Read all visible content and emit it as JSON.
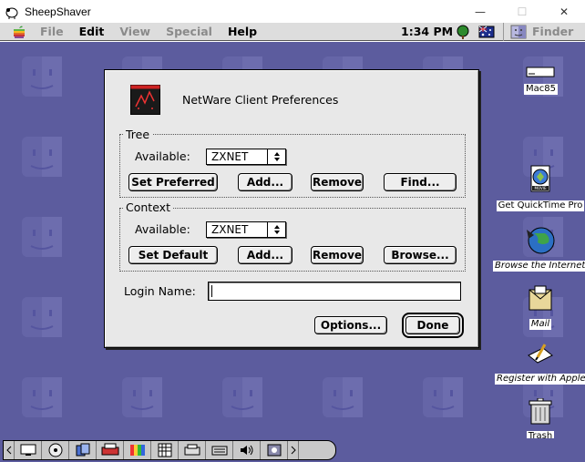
{
  "host_window": {
    "title": "SheepShaver",
    "minimize_glyph": "—",
    "maximize_glyph": "☐",
    "close_glyph": "✕"
  },
  "menubar": {
    "items": [
      "File",
      "Edit",
      "View",
      "Special",
      "Help"
    ],
    "active_items": [
      false,
      true,
      false,
      false,
      true
    ],
    "clock": "1:34 PM",
    "app_menu": "Finder"
  },
  "desktop": {
    "icons": [
      {
        "label": "Mac85",
        "icon": "hard-disk-icon"
      },
      {
        "label": "Get QuickTime Pro",
        "icon": "quicktime-icon"
      },
      {
        "label": "Browse the Internet",
        "icon": "internet-globe-icon"
      },
      {
        "label": "Mail",
        "icon": "mail-icon"
      },
      {
        "label": "Register with Apple",
        "icon": "register-icon"
      },
      {
        "label": "Trash",
        "icon": "trash-icon"
      }
    ]
  },
  "dialog": {
    "title": "NetWare Client Preferences",
    "tree": {
      "group_label": "Tree",
      "available_label": "Available:",
      "available_value": "ZXNET",
      "buttons": [
        "Set Preferred",
        "Add...",
        "Remove",
        "Find..."
      ]
    },
    "context": {
      "group_label": "Context",
      "available_label": "Available:",
      "available_value": "ZXNET",
      "buttons": [
        "Set Default",
        "Add...",
        "Remove",
        "Browse..."
      ]
    },
    "login_label": "Login Name:",
    "login_value": "",
    "options_label": "Options...",
    "done_label": "Done"
  },
  "colors": {
    "desktop": "#5c5c9e",
    "dialog_bg": "#e8e8e8",
    "menubar_bg": "#dddddd"
  }
}
